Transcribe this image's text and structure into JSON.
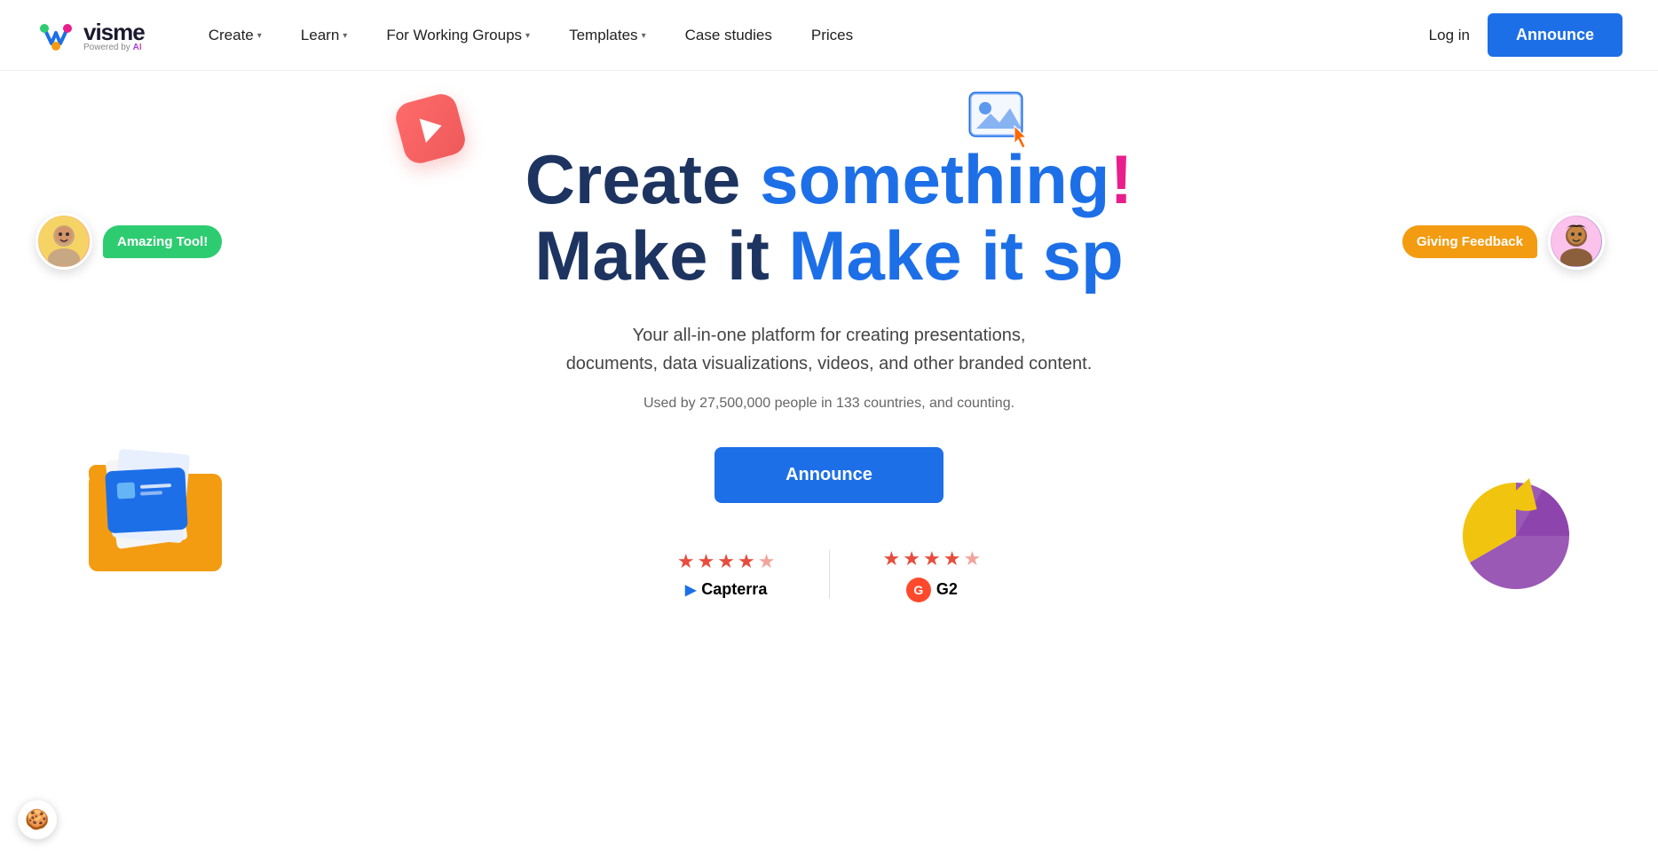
{
  "nav": {
    "logo_brand": "visme",
    "logo_powered_prefix": "Powered by ",
    "logo_powered_ai": "AI",
    "items": [
      {
        "label": "Create",
        "has_dropdown": true
      },
      {
        "label": "Learn",
        "has_dropdown": true
      },
      {
        "label": "For Working Groups",
        "has_dropdown": true
      },
      {
        "label": "Templates",
        "has_dropdown": true
      },
      {
        "label": "Case studies",
        "has_dropdown": false
      },
      {
        "label": "Prices",
        "has_dropdown": false
      }
    ],
    "login_label": "Log in",
    "announce_label": "Announce"
  },
  "hero": {
    "title_line1_part1": "Create ",
    "title_line1_part2": "something",
    "title_line1_part3": "!",
    "title_line2_part1": "Make it sp",
    "subtitle_line1": "Your all-in-one platform for creating presentations,",
    "subtitle_line2": "documents, data visualizations, videos, and other branded content.",
    "used_text": "Used by 27,500,000 people in 133 countries, and counting.",
    "cta_label": "Announce",
    "left_bubble_text": "Amazing Tool!",
    "right_bubble_text": "Giving Feedback",
    "capterra_label": "Capterra",
    "g2_label": "G2"
  },
  "cookie": {
    "icon": "🍪"
  }
}
